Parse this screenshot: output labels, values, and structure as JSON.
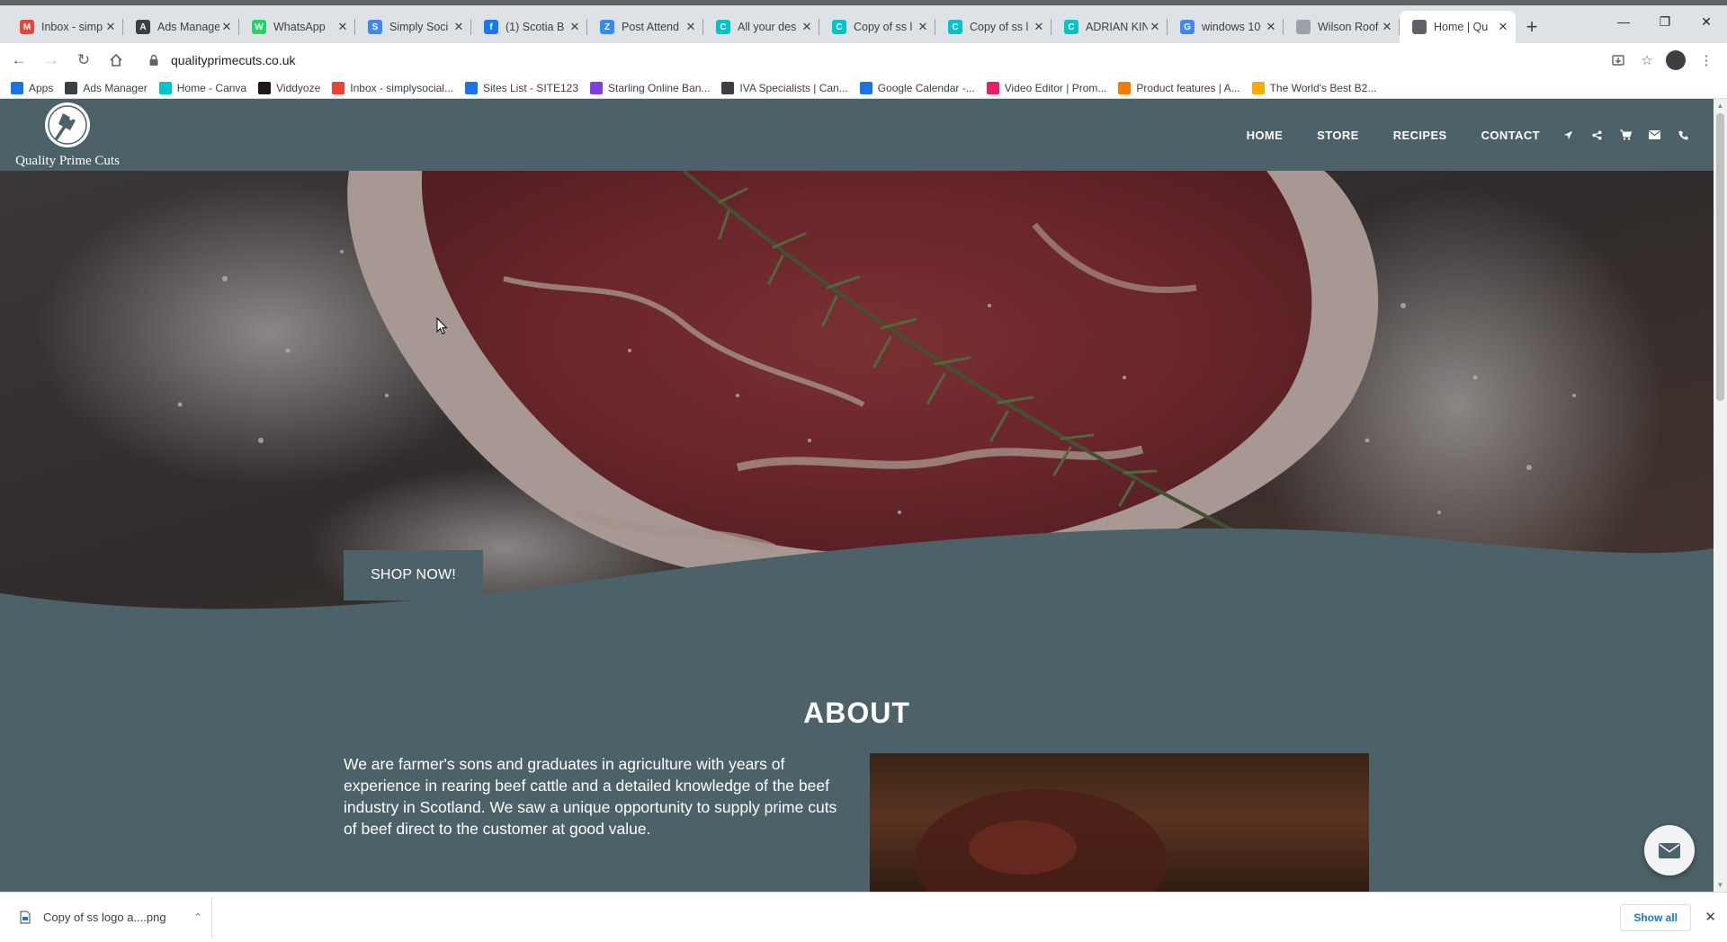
{
  "browser": {
    "tabs": [
      {
        "title": "Inbox - simp",
        "icon": "gmail-icon",
        "color": "#ea4335",
        "letter": "M"
      },
      {
        "title": "Ads Manager",
        "icon": "ads-manager-icon",
        "color": "#3c4043",
        "letter": "A"
      },
      {
        "title": "WhatsApp",
        "icon": "whatsapp-icon",
        "color": "#25d366",
        "letter": "W"
      },
      {
        "title": "Simply Soci",
        "icon": "docs-icon",
        "color": "#4285f4",
        "letter": "S"
      },
      {
        "title": "(1) Scotia B",
        "icon": "facebook-icon",
        "color": "#1877f2",
        "letter": "f"
      },
      {
        "title": "Post Attend",
        "icon": "zoom-icon",
        "color": "#2d8cff",
        "letter": "Z"
      },
      {
        "title": "All your des",
        "icon": "canva-icon",
        "color": "#00c4cc",
        "letter": "C"
      },
      {
        "title": "Copy of ss l",
        "icon": "canva-icon",
        "color": "#00c4cc",
        "letter": "C"
      },
      {
        "title": "Copy of ss l",
        "icon": "canva-icon",
        "color": "#00c4cc",
        "letter": "C"
      },
      {
        "title": "ADRIAN KIN",
        "icon": "canva-icon",
        "color": "#00c4cc",
        "letter": "C"
      },
      {
        "title": "windows 10",
        "icon": "google-icon",
        "color": "#4285f4",
        "letter": "G"
      },
      {
        "title": "Wilson Roof",
        "icon": "page-icon",
        "color": "#9aa0a6",
        "letter": ""
      },
      {
        "title": "Home | Qu",
        "icon": "site-icon",
        "color": "#5f6368",
        "letter": "",
        "active": true
      }
    ],
    "url": "qualityprimecuts.co.uk",
    "bookmarks": [
      {
        "label": "Apps",
        "icon": "apps-grid-icon",
        "color": "#1a73e8"
      },
      {
        "label": "Ads Manager",
        "icon": "ads-manager-icon",
        "color": "#3c4043"
      },
      {
        "label": "Home - Canva",
        "icon": "canva-icon",
        "color": "#00c4cc"
      },
      {
        "label": "Viddyoze",
        "icon": "viddyoze-icon",
        "color": "#1a1a1a"
      },
      {
        "label": "Inbox - simplysocial...",
        "icon": "gmail-icon",
        "color": "#ea4335"
      },
      {
        "label": "Sites List - SITE123",
        "icon": "site123-icon",
        "color": "#1a73e8"
      },
      {
        "label": "Starling Online Ban...",
        "icon": "starling-icon",
        "color": "#7b3fe4"
      },
      {
        "label": "IVA Specialists | Can...",
        "icon": "globe-icon",
        "color": "#3c4043"
      },
      {
        "label": "Google Calendar -...",
        "icon": "calendar-icon",
        "color": "#1a73e8"
      },
      {
        "label": "Video Editor | Prom...",
        "icon": "promo-icon",
        "color": "#e91e63"
      },
      {
        "label": "Product features | A...",
        "icon": "cloud-icon",
        "color": "#f57c00"
      },
      {
        "label": "The World's Best B2...",
        "icon": "b2b-icon",
        "color": "#f9ab00"
      }
    ]
  },
  "site": {
    "logo_text": "Quality Prime Cuts",
    "nav": [
      "HOME",
      "STORE",
      "RECIPES",
      "CONTACT"
    ],
    "nav_icons": [
      "location-arrow-icon",
      "share-icon",
      "cart-icon",
      "envelope-icon",
      "phone-icon"
    ],
    "hero_button": "SHOP NOW!",
    "about": {
      "title": "ABOUT",
      "paragraph": "We are farmer's sons and graduates in agriculture with years of experience in rearing beef cattle and a detailed knowledge of the beef industry in Scotland. We saw a unique opportunity to supply prime cuts of beef direct to the customer at good value."
    },
    "colors": {
      "header": "#4d6268",
      "accent": "#4d6268"
    }
  },
  "downloads": {
    "file": "Copy of ss logo a....png",
    "show_all": "Show all"
  }
}
